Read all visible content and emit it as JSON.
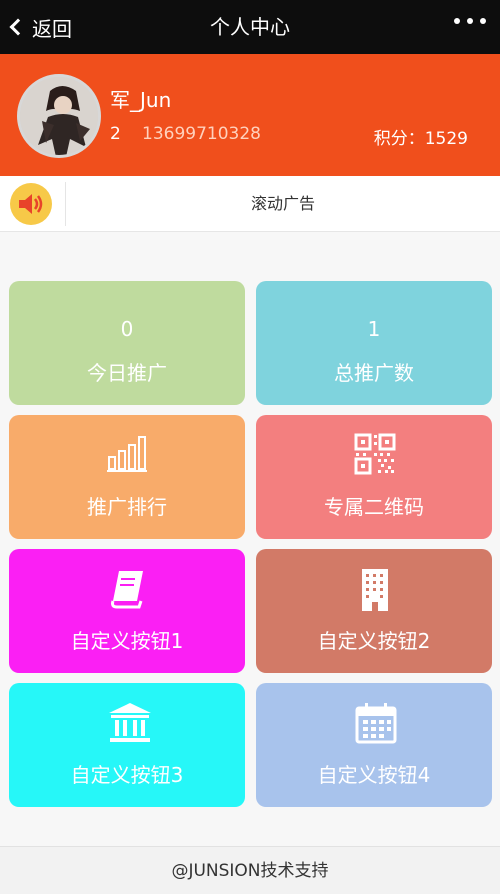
{
  "header": {
    "back_label": "返回",
    "title": "个人中心"
  },
  "profile": {
    "name": "军_Jun",
    "level": "2",
    "phone": "13699710328",
    "points_label": "积分：1529"
  },
  "ad": {
    "text": "滚动广告"
  },
  "tiles": [
    {
      "value": "0",
      "label": "今日推广",
      "color": "#bfdb9e"
    },
    {
      "value": "1",
      "label": "总推广数",
      "color": "#7fd3dd"
    },
    {
      "label": "推广排行",
      "icon": "bar-chart-icon",
      "color": "#f8ab6a"
    },
    {
      "label": "专属二维码",
      "icon": "qr-code-icon",
      "color": "#f37f7f"
    },
    {
      "label": "自定义按钮1",
      "icon": "book-icon",
      "color": "#fb1ff4"
    },
    {
      "label": "自定义按钮2",
      "icon": "building-icon",
      "color": "#d27a67"
    },
    {
      "label": "自定义按钮3",
      "icon": "bank-icon",
      "color": "#26f7f8"
    },
    {
      "label": "自定义按钮4",
      "icon": "calendar-icon",
      "color": "#a8c3ec"
    }
  ],
  "footer": {
    "text": "@JUNSION技术支持"
  },
  "colors": {
    "topbar": "#0d0d0d",
    "profile_bg": "#f04f1c",
    "speaker": "#f7c948"
  }
}
